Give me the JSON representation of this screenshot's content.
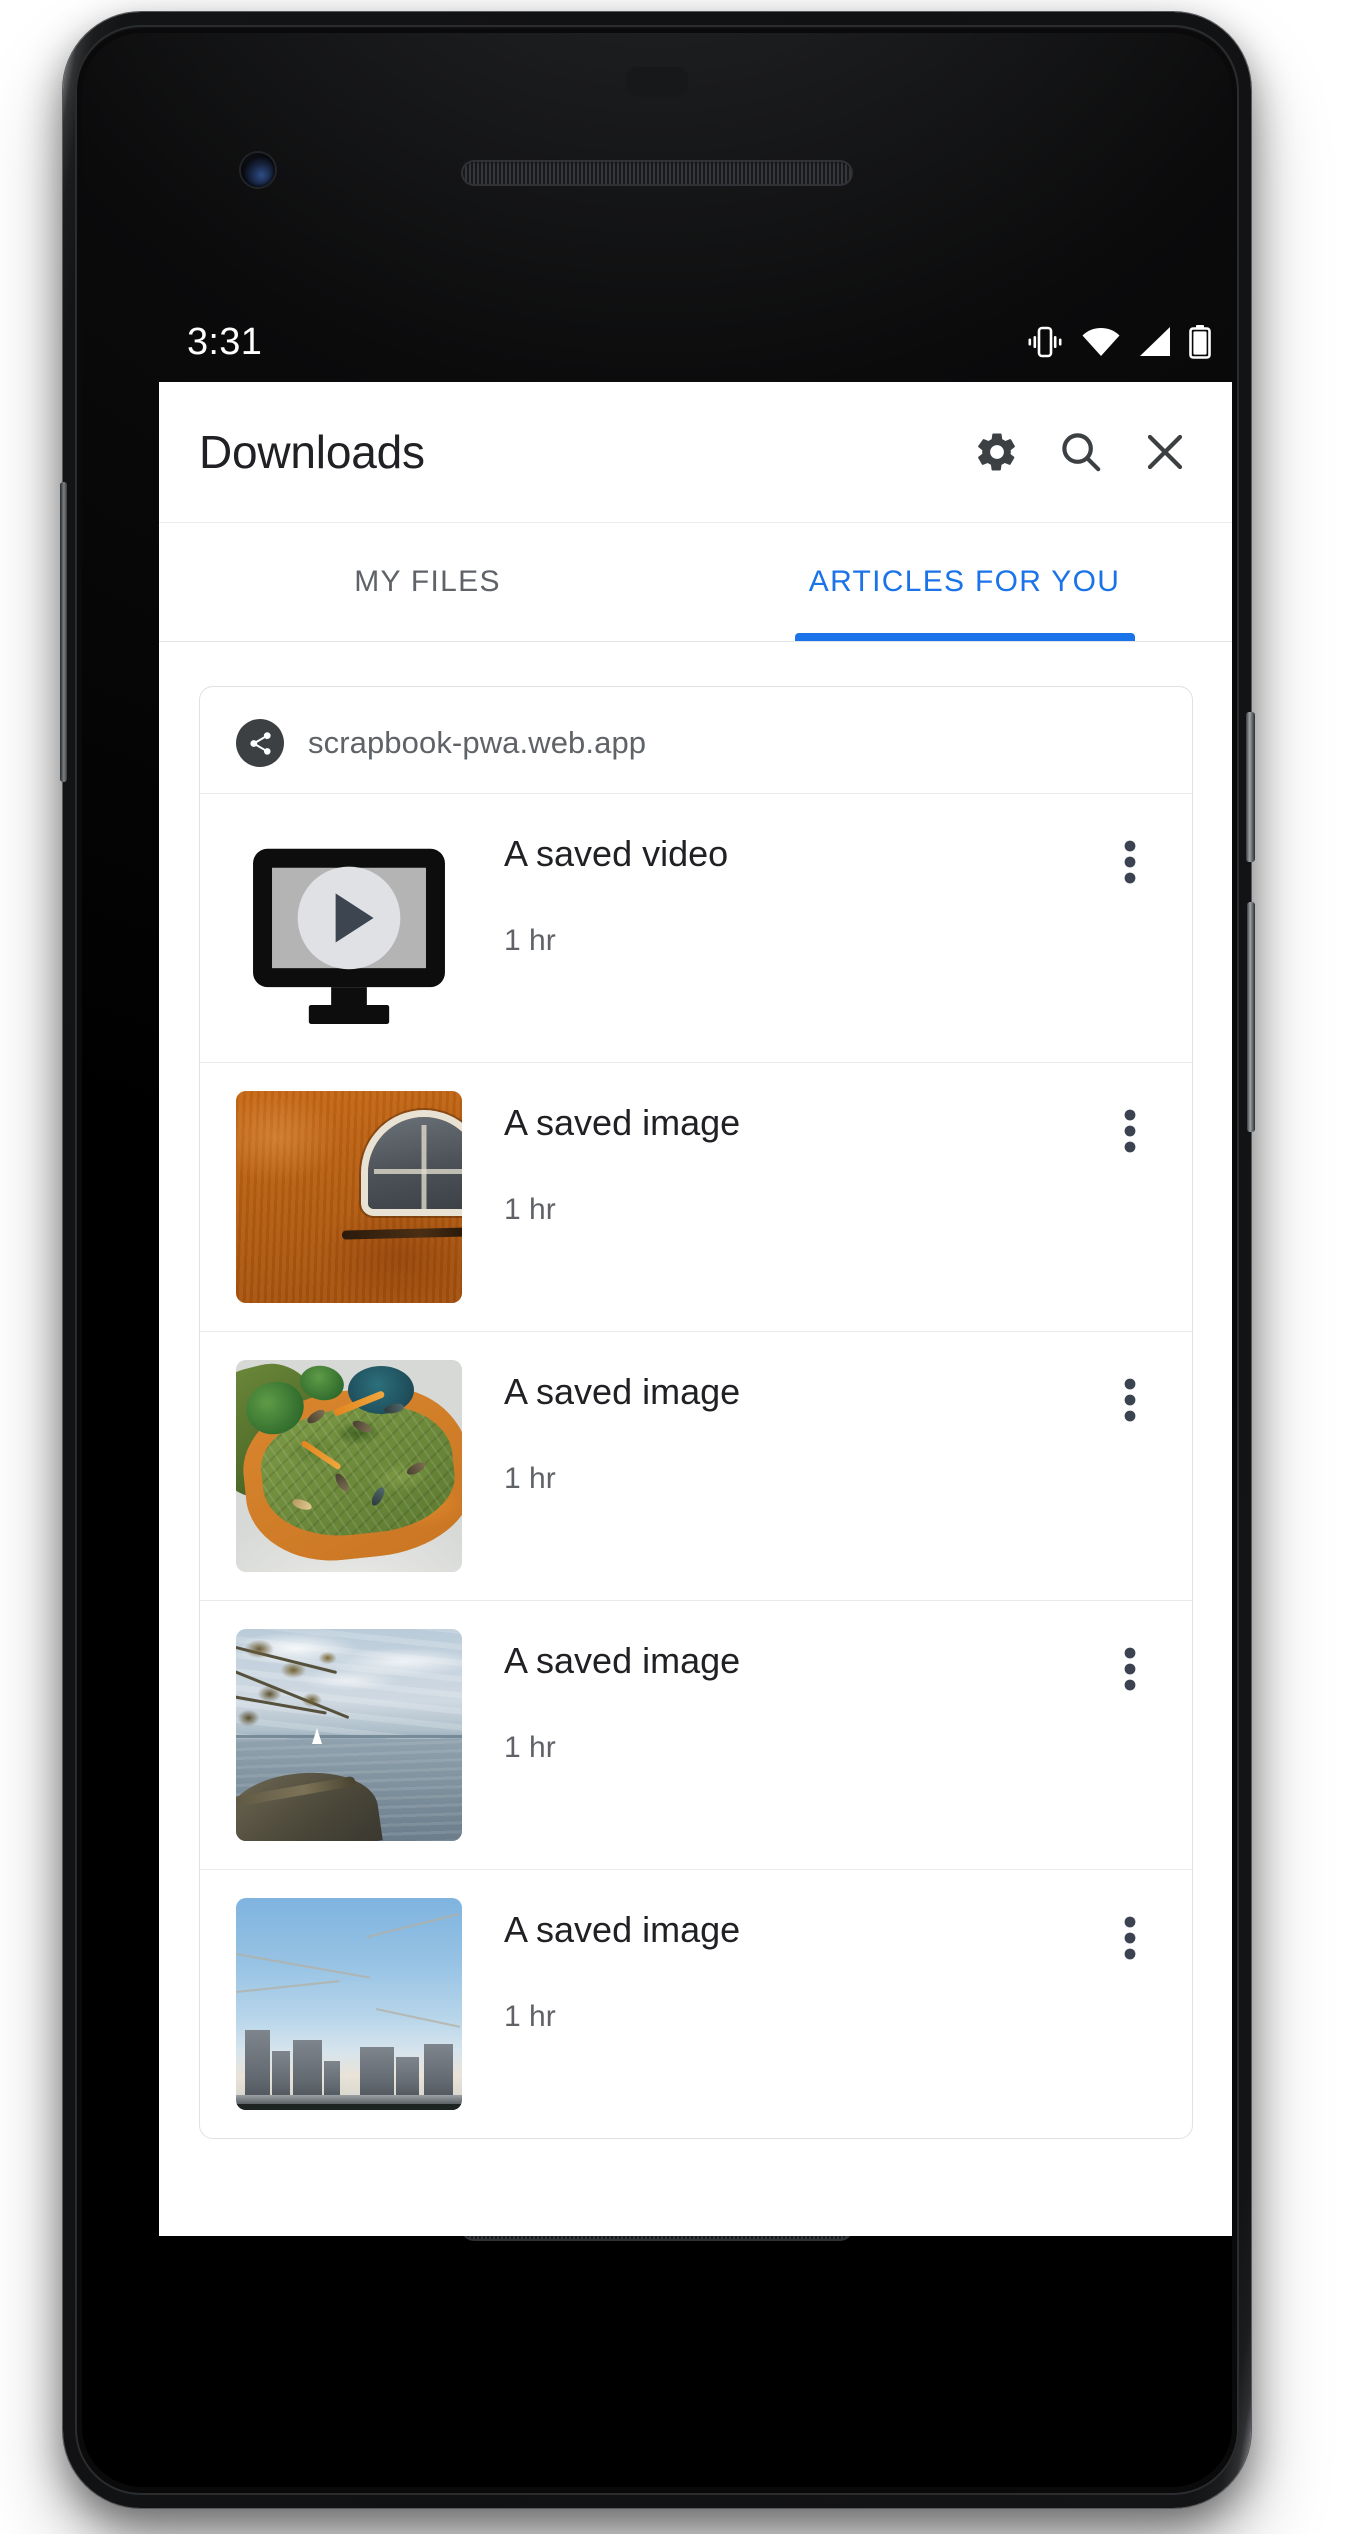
{
  "device": {
    "frame_color": "#101113",
    "hardware": {
      "front_camera": "front-camera",
      "earpiece_speaker": "earpiece-speaker-grille",
      "bottom_speaker": "bottom-speaker-grille",
      "power_button": "power-button",
      "volume_button": "volume-rocker-button"
    }
  },
  "status_bar": {
    "time": "3:31",
    "icons": [
      "vibrate-mode-icon",
      "wifi-full-icon",
      "cellular-signal-icon",
      "battery-full-icon"
    ]
  },
  "app_bar": {
    "title": "Downloads",
    "actions": [
      {
        "name": "settings-button",
        "icon": "gear-icon"
      },
      {
        "name": "search-button",
        "icon": "search-icon"
      },
      {
        "name": "close-button",
        "icon": "close-icon"
      }
    ]
  },
  "tabs": {
    "active_index": 1,
    "accent_color": "#1a73e8",
    "inactive_color": "#5f6368",
    "items": [
      {
        "label": "MY FILES"
      },
      {
        "label": "ARTICLES FOR YOU"
      }
    ]
  },
  "card": {
    "header": {
      "favicon": "share-icon",
      "favicon_bg": "#3c4043",
      "origin": "scrapbook-pwa.web.app"
    },
    "items": [
      {
        "title": "A saved video",
        "subtitle": "1 hr",
        "thumbnail": "video-placeholder-icon",
        "overflow": "more-options-icon"
      },
      {
        "title": "A saved image",
        "subtitle": "1 hr",
        "thumbnail": "photo-orange-wall-arched-window",
        "overflow": "more-options-icon"
      },
      {
        "title": "A saved image",
        "subtitle": "1 hr",
        "thumbnail": "photo-avocado-toast-plate",
        "overflow": "more-options-icon"
      },
      {
        "title": "A saved image",
        "subtitle": "1 hr",
        "thumbnail": "photo-lake-shoreline-sailboat",
        "overflow": "more-options-icon"
      },
      {
        "title": "A saved image",
        "subtitle": "1 hr",
        "thumbnail": "photo-city-skyline-blossoms",
        "overflow": "more-options-icon"
      }
    ]
  },
  "colors": {
    "title_text": "#202124",
    "secondary_text": "#5f6368",
    "card_border": "#dfe1e3",
    "divider": "#e8eaec",
    "surface": "#ffffff"
  }
}
